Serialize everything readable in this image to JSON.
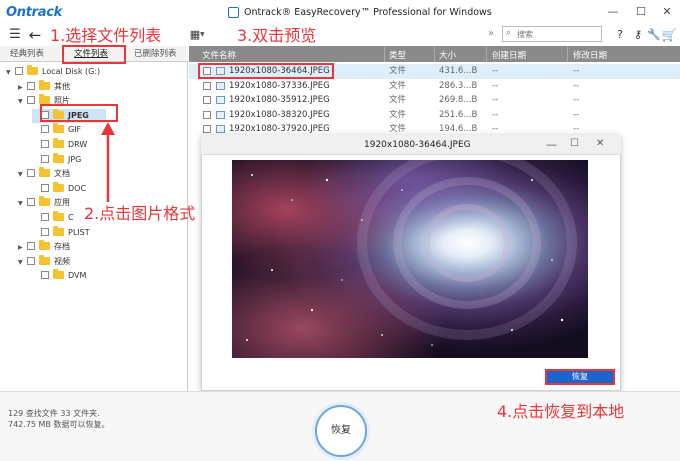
{
  "app": {
    "logo": "Ontrack",
    "window_title": "Ontrack® EasyRecovery™ Professional for Windows"
  },
  "window_controls": {
    "minimize": "—",
    "maximize": "☐",
    "close": "✕"
  },
  "toolbar": {
    "menu_icon": "hamburger-icon",
    "back_icon": "back-arrow-icon",
    "search_placeholder": "搜索",
    "right_icons": [
      "help-icon",
      "key-icon",
      "wrench-icon",
      "cart-icon"
    ]
  },
  "left_tabs": [
    "经典列表",
    "文件列表",
    "已删除列表"
  ],
  "tree": [
    {
      "label": "Local Disk (G:)",
      "caret": "▼",
      "level": 0
    },
    {
      "label": "其他",
      "caret": "▶",
      "level": 1
    },
    {
      "label": "照片",
      "caret": "▼",
      "level": 1
    },
    {
      "label": "JPEG",
      "caret": "",
      "level": 2
    },
    {
      "label": "GIF",
      "caret": "",
      "level": 2
    },
    {
      "label": "DRW",
      "caret": "",
      "level": 2
    },
    {
      "label": "JPG",
      "caret": "",
      "level": 2
    },
    {
      "label": "文档",
      "caret": "▼",
      "level": 1
    },
    {
      "label": "DOC",
      "caret": "",
      "level": 2
    },
    {
      "label": "应用",
      "caret": "▼",
      "level": 1
    },
    {
      "label": "C",
      "caret": "",
      "level": 2
    },
    {
      "label": "PLIST",
      "caret": "",
      "level": 2
    },
    {
      "label": "存档",
      "caret": "▶",
      "level": 1
    },
    {
      "label": "视频",
      "caret": "▼",
      "level": 1
    },
    {
      "label": "DVM",
      "caret": "",
      "level": 2
    }
  ],
  "list_columns": [
    "文件名称",
    "类型",
    "大小",
    "创建日期",
    "修改日期"
  ],
  "files": [
    {
      "name": "1920x1080-36464.JPEG",
      "type": "文件",
      "size": "431.6...B",
      "created": "--",
      "modified": "--"
    },
    {
      "name": "1920x1080-37336.JPEG",
      "type": "文件",
      "size": "286.3...B",
      "created": "--",
      "modified": "--"
    },
    {
      "name": "1920x1080-35912.JPEG",
      "type": "文件",
      "size": "269.8...B",
      "created": "--",
      "modified": "--"
    },
    {
      "name": "1920x1080-38320.JPEG",
      "type": "文件",
      "size": "251.6...B",
      "created": "--",
      "modified": "--"
    },
    {
      "name": "1920x1080-37920.JPEG",
      "type": "文件",
      "size": "194.6...B",
      "created": "--",
      "modified": "--"
    }
  ],
  "preview": {
    "title": "1920x1080-36464.JPEG",
    "recover_label": "恢复"
  },
  "status": {
    "line1": "129 查找文件 33 文件夹.",
    "line2": "742.75 MB 数据可以恢复。"
  },
  "recover_button": "恢复",
  "annotations": {
    "step1": "1.选择文件列表",
    "step2": "2.点击图片格式",
    "step3": "3.双击预览",
    "step4": "4.点击恢复到本地"
  },
  "colors": {
    "accent": "#1a73c8",
    "annotation": "#e8363a",
    "header_gray": "#8a8a8a",
    "preview_button": "#1a66cc"
  }
}
